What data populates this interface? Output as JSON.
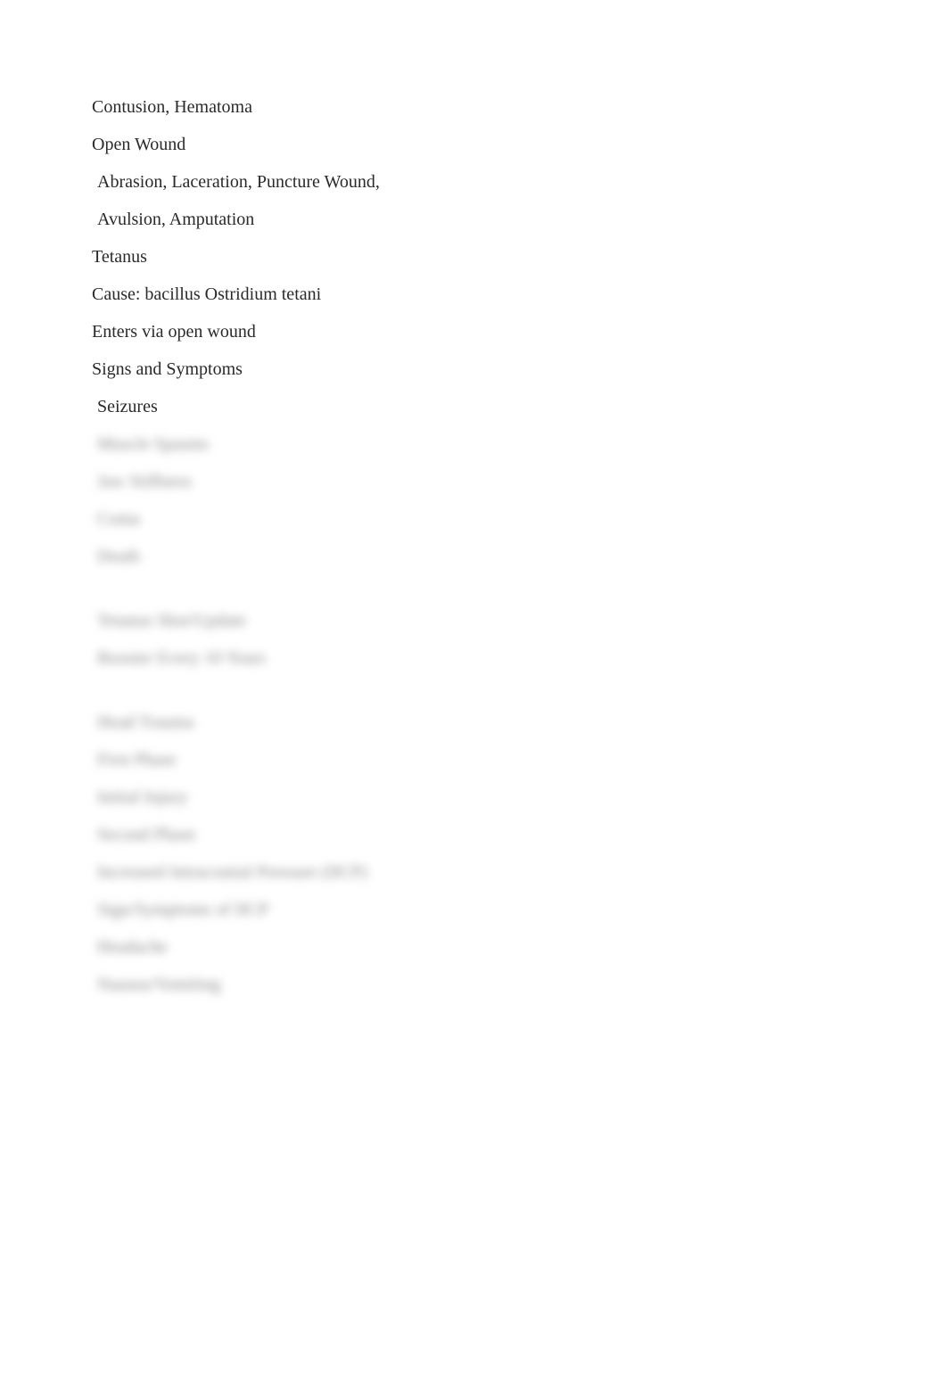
{
  "lines": [
    {
      "text": "Contusion, Hematoma",
      "indent": false,
      "blurred": false,
      "gapAfter": false
    },
    {
      "text": "Open Wound",
      "indent": false,
      "blurred": false,
      "gapAfter": false
    },
    {
      "text": "Abrasion, Laceration, Puncture Wound,",
      "indent": true,
      "blurred": false,
      "gapAfter": false
    },
    {
      "text": "Avulsion, Amputation",
      "indent": true,
      "blurred": false,
      "gapAfter": false
    },
    {
      "text": "Tetanus",
      "indent": false,
      "blurred": false,
      "gapAfter": false
    },
    {
      "text": "Cause: bacillus Ostridium tetani",
      "indent": false,
      "blurred": false,
      "gapAfter": false
    },
    {
      "text": "Enters via open wound",
      "indent": false,
      "blurred": false,
      "gapAfter": false
    },
    {
      "text": "Signs and Symptoms",
      "indent": false,
      "blurred": false,
      "gapAfter": false
    },
    {
      "text": "Seizures",
      "indent": true,
      "blurred": false,
      "gapAfter": false
    },
    {
      "text": "Muscle Spasms",
      "indent": true,
      "blurred": true,
      "gapAfter": false
    },
    {
      "text": "Jaw Stiffness",
      "indent": true,
      "blurred": true,
      "gapAfter": false
    },
    {
      "text": "Coma",
      "indent": true,
      "blurred": true,
      "gapAfter": false
    },
    {
      "text": "Death",
      "indent": true,
      "blurred": true,
      "gapAfter": true
    },
    {
      "text": "Tetanus Shot/Update",
      "indent": true,
      "blurred": true,
      "gapAfter": false
    },
    {
      "text": "Booster Every 10 Years",
      "indent": true,
      "blurred": true,
      "gapAfter": true
    },
    {
      "text": "Head Trauma",
      "indent": true,
      "blurred": true,
      "gapAfter": false
    },
    {
      "text": "First Phase",
      "indent": true,
      "blurred": true,
      "gapAfter": false
    },
    {
      "text": "Initial Injury",
      "indent": true,
      "blurred": true,
      "gapAfter": false
    },
    {
      "text": "Second Phase",
      "indent": true,
      "blurred": true,
      "gapAfter": false
    },
    {
      "text": "Increased Intracranial Pressure (IICP)",
      "indent": true,
      "blurred": true,
      "gapAfter": false
    },
    {
      "text": "Sign/Symptoms of IICP",
      "indent": true,
      "blurred": true,
      "gapAfter": false
    },
    {
      "text": "Headache",
      "indent": true,
      "blurred": true,
      "gapAfter": false
    },
    {
      "text": "Nausea/Vomiting",
      "indent": true,
      "blurred": true,
      "gapAfter": false
    }
  ]
}
